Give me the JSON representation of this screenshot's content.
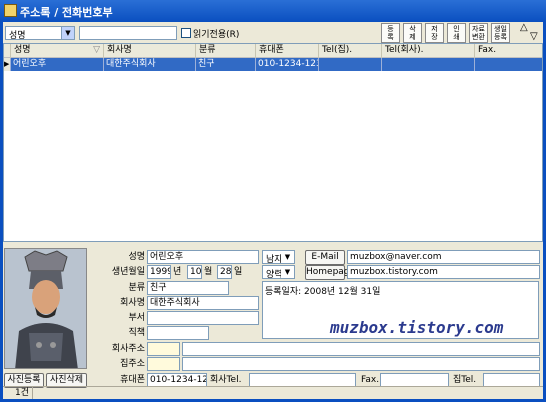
{
  "window": {
    "title": "주소록 / 전화번호부"
  },
  "toolbar": {
    "search_field_value": "성명",
    "search_input_value": "",
    "readonly_label": "읽기전용(R)",
    "buttons": [
      {
        "label": "등\n록"
      },
      {
        "label": "삭\n제"
      },
      {
        "label": "저\n장"
      },
      {
        "label": "인\n쇄"
      },
      {
        "label": "자료\n변환"
      },
      {
        "label": "생일\n등록"
      }
    ],
    "up_arrow": "△",
    "down_arrow": "▽"
  },
  "grid": {
    "columns": [
      "성명",
      "회사명",
      "분류",
      "휴대폰",
      "Tel(집).",
      "Tel(회사).",
      "Fax."
    ],
    "rows": [
      {
        "cells": [
          "어린오후",
          "대한주식회사",
          "친구",
          "010-1234-1234",
          "",
          "",
          ""
        ]
      }
    ],
    "row_marker": "▶"
  },
  "detail": {
    "name_label": "성명",
    "name_value": "어린오후",
    "gender_value": "남자",
    "email_button": "E-Mail",
    "email_value": "muzbox@naver.com",
    "birth_label": "생년월일",
    "birth_year": "1999",
    "year_unit": "년",
    "birth_month": "10",
    "month_unit": "월",
    "birth_day": "28",
    "day_unit": "일",
    "calendar_value": "양력",
    "homepage_button": "Homepage",
    "homepage_value": "muzbox.tistory.com",
    "category_label": "분류",
    "category_value": "친구",
    "company_label": "회사명",
    "company_value": "대한주식회사",
    "dept_label": "부서",
    "dept_value": "",
    "title_label": "직책",
    "title_value": "",
    "memo_text": "등록일자: 2008년 12월 31일",
    "watermark": "muzbox.tistory.com",
    "company_addr_label": "회사주소",
    "company_addr_zip": "",
    "company_addr_value": "",
    "home_addr_label": "집주소",
    "home_addr_zip": "",
    "home_addr_value": "",
    "mobile_label": "휴대폰",
    "mobile_value": "010-1234-1234",
    "company_tel_label": "회사Tel.",
    "company_tel_value": "",
    "fax_label": "Fax.",
    "fax_value": "",
    "home_tel_label": "집Tel.",
    "home_tel_value": "",
    "photo_register_button": "사진등록",
    "photo_delete_button": "사진삭제"
  },
  "status": {
    "count": "1건"
  },
  "colors": {
    "title_bar": "#0a4fc0",
    "selection": "#316ac5",
    "memo_highlight": "#fffadc"
  }
}
